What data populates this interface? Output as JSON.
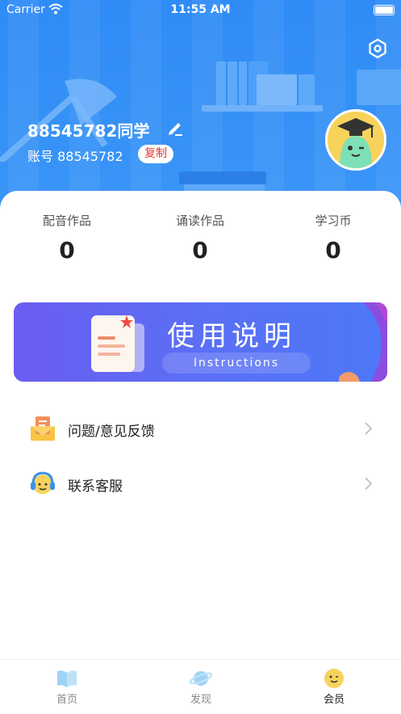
{
  "status_bar": {
    "carrier": "Carrier",
    "time": "11:55 AM"
  },
  "profile": {
    "username": "88545782同学",
    "account_label": "账号 88545782",
    "copy_label": "复制"
  },
  "stats": [
    {
      "label": "配音作品",
      "value": "0"
    },
    {
      "label": "诵读作品",
      "value": "0"
    },
    {
      "label": "学习币",
      "value": "0"
    }
  ],
  "banner": {
    "title": "使用说明",
    "subtitle": "Instructions"
  },
  "menu": [
    {
      "label": "问题/意见反馈",
      "icon": "mail-icon"
    },
    {
      "label": "联系客服",
      "icon": "headset-icon"
    }
  ],
  "tabbar": [
    {
      "label": "首页",
      "icon": "book-icon"
    },
    {
      "label": "发现",
      "icon": "planet-icon"
    },
    {
      "label": "会员",
      "icon": "smiley-icon",
      "active": true
    }
  ],
  "colors": {
    "primary": "#3b96f7",
    "accent": "#e53935",
    "banner": "#6a5cf1"
  }
}
